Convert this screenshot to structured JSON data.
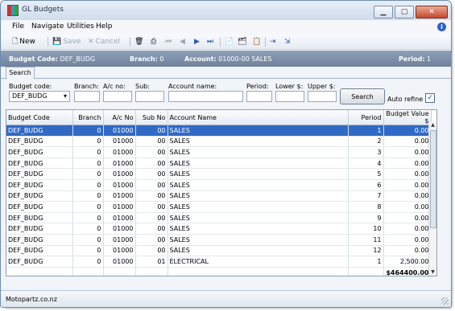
{
  "window": {
    "title": "GL Budgets"
  },
  "menu": [
    "File",
    "Navigate",
    "Utilities",
    "Help"
  ],
  "toolbar": {
    "new_label": "New",
    "save_label": "Save",
    "cancel_label": "Cancel"
  },
  "header": {
    "budget_code_label": "Budget Code:",
    "budget_code_value": "DEF_BUDG",
    "branch_label": "Branch:",
    "branch_value": "0",
    "account_label": "Account:",
    "account_value": "01000-00 SALES",
    "period_label": "Period:",
    "period_value": "1"
  },
  "tabs": [
    "Search"
  ],
  "search": {
    "budget_code_label": "Budget code:",
    "budget_code_value": "DEF_BUDG",
    "branch_label": "Branch:",
    "acno_label": "A/c no:",
    "sub_label": "Sub:",
    "account_name_label": "Account name:",
    "period_label": "Period:",
    "lower_label": "Lower $:",
    "upper_label": "Upper $:",
    "search_button": "Search",
    "auto_refine_label": "Auto refine",
    "auto_refine_checked": true
  },
  "grid": {
    "columns": [
      "Budget Code",
      "Branch",
      "A/c No",
      "Sub No",
      "Account Name",
      "Period",
      "Budget Value $"
    ],
    "rows": [
      [
        "DEF_BUDG",
        "0",
        "01000",
        "00",
        "SALES",
        "1",
        "0.00"
      ],
      [
        "DEF_BUDG",
        "0",
        "01000",
        "00",
        "SALES",
        "2",
        "0.00"
      ],
      [
        "DEF_BUDG",
        "0",
        "01000",
        "00",
        "SALES",
        "3",
        "0.00"
      ],
      [
        "DEF_BUDG",
        "0",
        "01000",
        "00",
        "SALES",
        "4",
        "0.00"
      ],
      [
        "DEF_BUDG",
        "0",
        "01000",
        "00",
        "SALES",
        "5",
        "0.00"
      ],
      [
        "DEF_BUDG",
        "0",
        "01000",
        "00",
        "SALES",
        "6",
        "0.00"
      ],
      [
        "DEF_BUDG",
        "0",
        "01000",
        "00",
        "SALES",
        "7",
        "0.00"
      ],
      [
        "DEF_BUDG",
        "0",
        "01000",
        "00",
        "SALES",
        "8",
        "0.00"
      ],
      [
        "DEF_BUDG",
        "0",
        "01000",
        "00",
        "SALES",
        "9",
        "0.00"
      ],
      [
        "DEF_BUDG",
        "0",
        "01000",
        "00",
        "SALES",
        "10",
        "0.00"
      ],
      [
        "DEF_BUDG",
        "0",
        "01000",
        "00",
        "SALES",
        "11",
        "0.00"
      ],
      [
        "DEF_BUDG",
        "0",
        "01000",
        "00",
        "SALES",
        "12",
        "0.00"
      ],
      [
        "DEF_BUDG",
        "0",
        "01000",
        "01",
        "ELECTRICAL",
        "1",
        "2,500.00"
      ]
    ],
    "total": "$464400.00"
  },
  "status": {
    "text": "Motopartz.co.nz"
  },
  "colors": {
    "selection": "#316ac5",
    "header_bar": "#7f91aa"
  }
}
